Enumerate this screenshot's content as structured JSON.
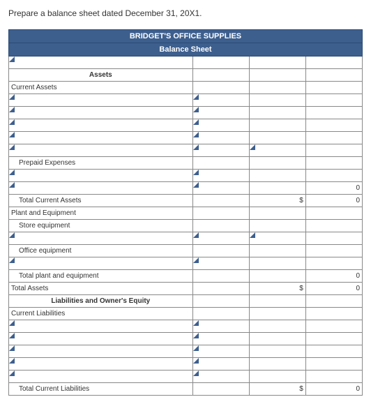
{
  "instruction": "Prepare a balance sheet dated December 31, 20X1.",
  "company": "BRIDGET'S OFFICE SUPPLIES",
  "title": "Balance Sheet",
  "sections": {
    "assets": "Assets",
    "liabEquity": "Liabilities and Owner's Equity"
  },
  "labels": {
    "currentAssets": "Current Assets",
    "prepaidExpenses": "Prepaid Expenses",
    "totalCurrentAssets": "Total Current Assets",
    "plantEquip": "Plant and Equipment",
    "storeEquip": "Store equipment",
    "officeEquip": "Office equipment",
    "totalPlantEquip": "Total plant and equipment",
    "totalAssets": "Total Assets",
    "currentLiab": "Current Liabilities",
    "totalCurrentLiab": "Total Current Liabilities"
  },
  "values": {
    "zero": "0",
    "dollar": "$"
  }
}
